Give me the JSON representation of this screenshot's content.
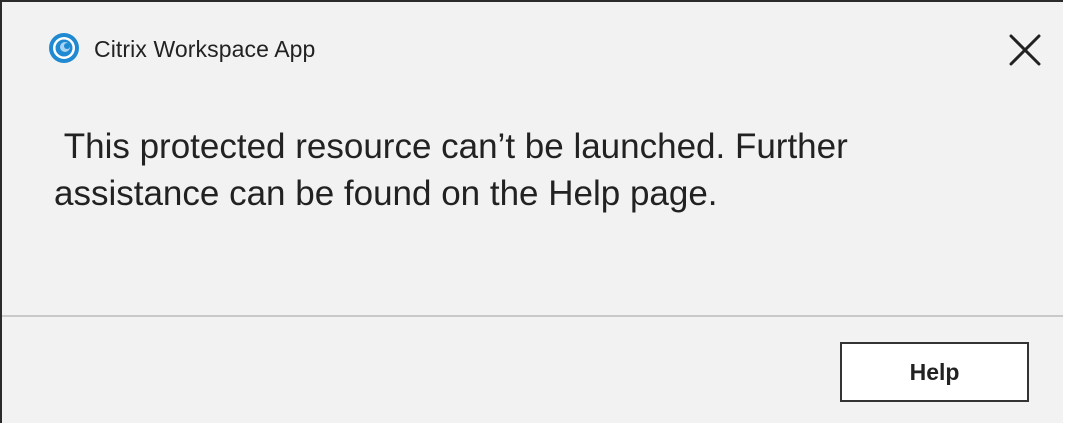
{
  "window": {
    "title": "Citrix Workspace App",
    "logo_icon": "citrix-logo-icon",
    "close_icon": "close-icon"
  },
  "dialog": {
    "message": " This protected resource can’t be launched. Further\nassistance can be found on the Help page."
  },
  "footer": {
    "help_label": "Help"
  },
  "colors": {
    "logo_blue": "#1f8ad2",
    "logo_light": "#a9d4f2",
    "background": "#f2f2f2",
    "text": "#222222"
  }
}
